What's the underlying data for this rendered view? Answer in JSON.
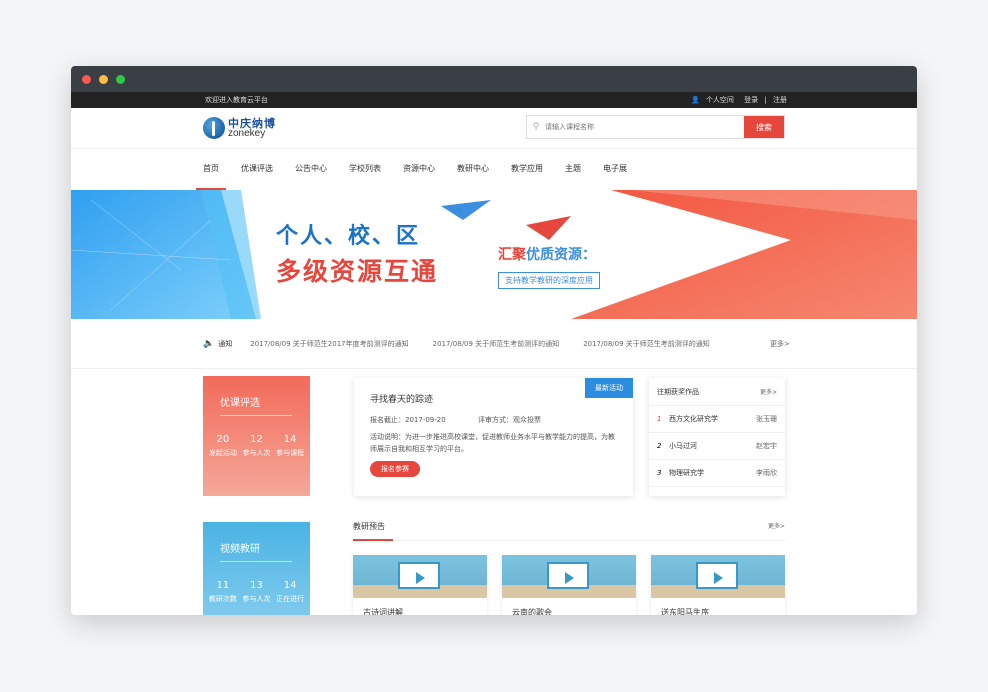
{
  "topbar": {
    "welcome": "欢迎进入教育云平台",
    "personal": "个人空间",
    "login": "登录",
    "sep": "|",
    "register": "注册"
  },
  "logo": {
    "cn": "中庆纳博",
    "en": "zonekey"
  },
  "search": {
    "placeholder": "请输入课程名称",
    "button": "搜索"
  },
  "nav": [
    "首页",
    "优课评选",
    "公告中心",
    "学校列表",
    "资源中心",
    "教研中心",
    "教学应用",
    "主题",
    "电子展"
  ],
  "banner": {
    "line1": "个人、校、区",
    "line2": "多级资源互通",
    "headline_a": "汇聚",
    "headline_b": "优质资源：",
    "sub": "支持教学教研的深度应用"
  },
  "notice": {
    "label": "通知",
    "items": [
      "2017/08/09  关于师范生2017年度考前测评的通知",
      "2017/08/09  关于师范生考前测评的通知",
      "2017/08/09  关于师范生考前测评的通知"
    ],
    "more": "更多>"
  },
  "course_card": {
    "title": "优课评选",
    "stats": [
      {
        "n": "20",
        "t": "发起活动"
      },
      {
        "n": "12",
        "t": "参与人次"
      },
      {
        "n": "14",
        "t": "参与课程"
      }
    ]
  },
  "video_card": {
    "title": "视频教研",
    "stats": [
      {
        "n": "11",
        "t": "教研次数"
      },
      {
        "n": "13",
        "t": "参与人次"
      },
      {
        "n": "14",
        "t": "正在进行"
      }
    ]
  },
  "activity": {
    "title": "寻找春天的踪迹",
    "badge": "最新活动",
    "deadline": "报名截止：2017-09-20",
    "method": "评审方式：观众投票",
    "desc": "活动说明：为进一步推进高校课堂，促进教师业务水平与教学能力的提高，为教师展示自我和相互学习的平台。",
    "join": "报名参赛"
  },
  "awards": {
    "title": "往期获奖作品",
    "more": "更多>",
    "rows": [
      {
        "no": "1",
        "name": "西方文化研究学",
        "author": "张玉珊"
      },
      {
        "no": "2",
        "name": "小马过河",
        "author": "赵宏宇"
      },
      {
        "no": "3",
        "name": "物理研究学",
        "author": "李雨欣"
      }
    ]
  },
  "research": {
    "title": "教研预告",
    "more": "更多>",
    "items": [
      "古诗词讲解",
      "云南的歌会",
      "送东阳马生序"
    ]
  },
  "colors": {
    "accent": "#e5473c",
    "blue": "#2a8de0",
    "dark": "#222222"
  }
}
